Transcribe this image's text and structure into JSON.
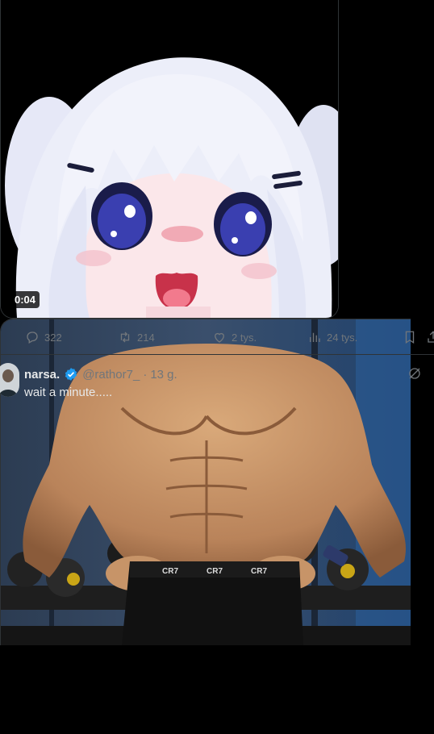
{
  "tweet1": {
    "video_timestamp": "0:04",
    "actions": {
      "replies": "322",
      "reposts": "214",
      "likes": "2 tys.",
      "views": "24 tys."
    }
  },
  "tweet2": {
    "author_name": "narsa.",
    "verified": true,
    "handle": "@rathor7_",
    "separator": "·",
    "time": "13 g.",
    "text": "wait a minute....."
  },
  "colors": {
    "background": "#000000",
    "muted_text": "#71767b",
    "verified_badge": "#1d9bf0",
    "divider": "#2f3336"
  },
  "icons": [
    "reply-icon",
    "repost-icon",
    "like-icon",
    "views-icon",
    "bookmark-icon",
    "share-icon",
    "grok-icon",
    "verified-icon"
  ]
}
